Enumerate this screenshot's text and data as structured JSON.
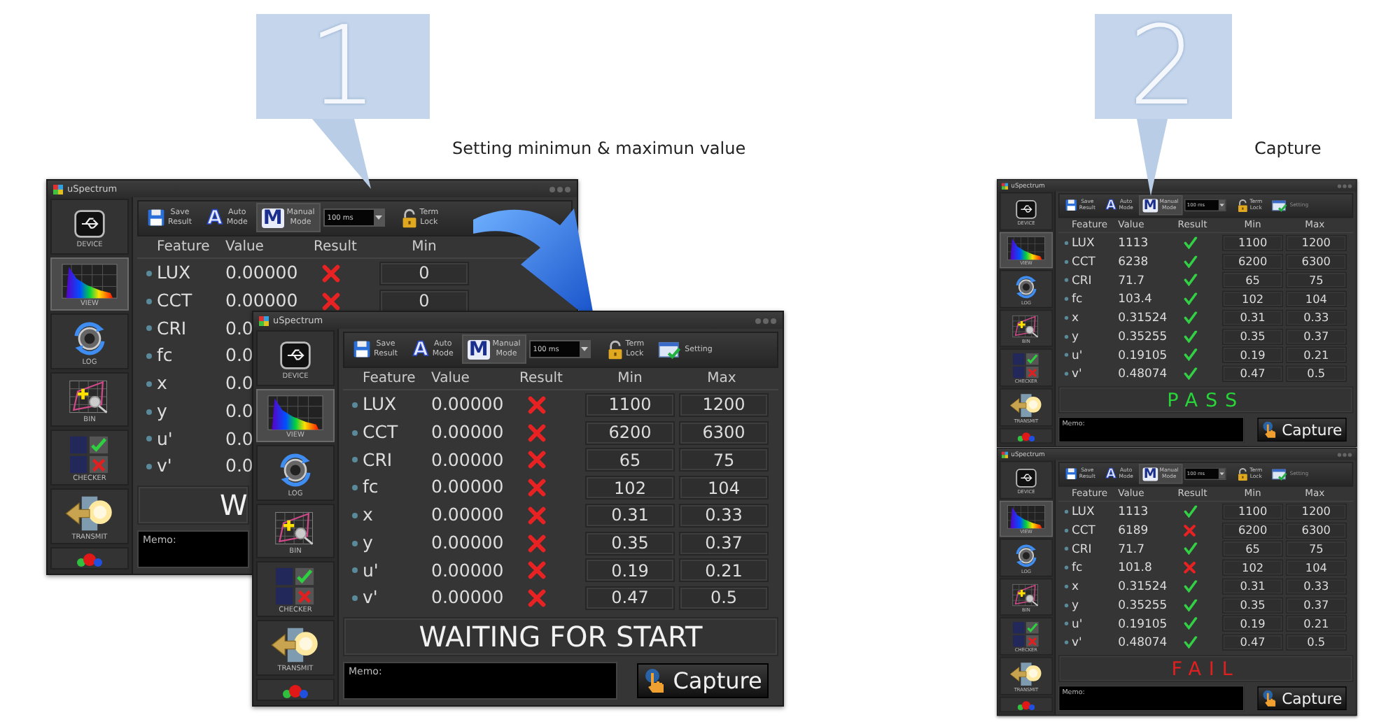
{
  "callouts": [
    {
      "number": "1",
      "caption": "Setting minimun & maximun value"
    },
    {
      "number": "2",
      "caption": "Capture"
    }
  ],
  "windows": [
    {
      "title": "uSpectrum",
      "sidebar": [
        {
          "kind": "device",
          "label": "DEVICE",
          "selected": false
        },
        {
          "kind": "view",
          "label": "VIEW",
          "selected": true
        },
        {
          "kind": "log",
          "label": "LOG",
          "selected": false
        },
        {
          "kind": "bin",
          "label": "BIN",
          "selected": false
        },
        {
          "kind": "checker",
          "label": "CHECKER",
          "selected": false
        },
        {
          "kind": "transmit",
          "label": "TRANSMIT",
          "selected": false
        },
        {
          "kind": "indicator",
          "selected": false
        }
      ],
      "toolbar": [
        {
          "kind": "save",
          "label": "Save\nResult"
        },
        {
          "kind": "mode",
          "glyph": "A",
          "label": "Auto\nMode",
          "selected": false
        },
        {
          "kind": "mode",
          "glyph": "M",
          "label": "Manual\nMode",
          "selected": true
        },
        {
          "kind": "dropdown",
          "value": "100 ms"
        },
        {
          "kind": "lock",
          "label": "Term\nLock"
        }
      ],
      "columns": [
        "Feature",
        "Value",
        "Result",
        "Min"
      ],
      "rows": [
        {
          "feature": "LUX",
          "value": "0.00000",
          "pass": false,
          "min": "0"
        },
        {
          "feature": "CCT",
          "value": "0.00000",
          "pass": false,
          "min": "0"
        },
        {
          "feature": "CRI",
          "value": "0.0"
        },
        {
          "feature": "fc",
          "value": "0.0"
        },
        {
          "feature": "x",
          "value": "0.0"
        },
        {
          "feature": "y",
          "value": "0.0"
        },
        {
          "feature": "u'",
          "value": "0.0"
        },
        {
          "feature": "v'",
          "value": "0.0"
        }
      ],
      "status": {
        "kind": "waiting",
        "text": "W"
      },
      "memo": "Memo:"
    },
    {
      "title": "uSpectrum",
      "sidebar": [
        {
          "kind": "device",
          "label": "DEVICE",
          "selected": false
        },
        {
          "kind": "view",
          "label": "VIEW",
          "selected": true
        },
        {
          "kind": "log",
          "label": "LOG",
          "selected": false
        },
        {
          "kind": "bin",
          "label": "BIN",
          "selected": false
        },
        {
          "kind": "checker",
          "label": "CHECKER",
          "selected": false
        },
        {
          "kind": "transmit",
          "label": "TRANSMIT",
          "selected": false
        },
        {
          "kind": "indicator",
          "selected": false
        }
      ],
      "toolbar": [
        {
          "kind": "save",
          "label": "Save\nResult"
        },
        {
          "kind": "mode",
          "glyph": "A",
          "label": "Auto\nMode",
          "selected": false
        },
        {
          "kind": "mode",
          "glyph": "M",
          "label": "Manual\nMode",
          "selected": true
        },
        {
          "kind": "dropdown",
          "value": "100 ms"
        },
        {
          "kind": "lock",
          "label": "Term\nLock"
        },
        {
          "kind": "setting",
          "label": "Setting",
          "disabled": false
        }
      ],
      "columns": [
        "Feature",
        "Value",
        "Result",
        "Min",
        "Max"
      ],
      "rows": [
        {
          "feature": "LUX",
          "value": "0.00000",
          "pass": false,
          "min": "1100",
          "max": "1200"
        },
        {
          "feature": "CCT",
          "value": "0.00000",
          "pass": false,
          "min": "6200",
          "max": "6300"
        },
        {
          "feature": "CRI",
          "value": "0.00000",
          "pass": false,
          "min": "65",
          "max": "75"
        },
        {
          "feature": "fc",
          "value": "0.00000",
          "pass": false,
          "min": "102",
          "max": "104"
        },
        {
          "feature": "x",
          "value": "0.00000",
          "pass": false,
          "min": "0.31",
          "max": "0.33"
        },
        {
          "feature": "y",
          "value": "0.00000",
          "pass": false,
          "min": "0.35",
          "max": "0.37"
        },
        {
          "feature": "u'",
          "value": "0.00000",
          "pass": false,
          "min": "0.19",
          "max": "0.21"
        },
        {
          "feature": "v'",
          "value": "0.00000",
          "pass": false,
          "min": "0.47",
          "max": "0.5"
        }
      ],
      "status": {
        "kind": "waiting",
        "text": "WAITING FOR START"
      },
      "memo": "Memo:",
      "capture": "Capture"
    },
    {
      "title": "uSpectrum",
      "sidebar": [
        {
          "kind": "device",
          "label": "DEVICE",
          "selected": false
        },
        {
          "kind": "view",
          "label": "VIEW",
          "selected": true
        },
        {
          "kind": "log",
          "label": "LOG",
          "selected": false
        },
        {
          "kind": "bin",
          "label": "BIN",
          "selected": false
        },
        {
          "kind": "checker",
          "label": "CHECKER",
          "selected": false
        },
        {
          "kind": "transmit",
          "label": "TRANSMIT",
          "selected": false
        },
        {
          "kind": "indicator",
          "selected": false
        }
      ],
      "toolbar": [
        {
          "kind": "save",
          "label": "Save\nResult"
        },
        {
          "kind": "mode",
          "glyph": "A",
          "label": "Auto\nMode",
          "selected": false
        },
        {
          "kind": "mode",
          "glyph": "M",
          "label": "Manual\nMode",
          "selected": true
        },
        {
          "kind": "dropdown",
          "value": "100 ms"
        },
        {
          "kind": "lock",
          "label": "Term\nLock"
        },
        {
          "kind": "setting",
          "label": "Setting",
          "disabled": true
        }
      ],
      "columns": [
        "Feature",
        "Value",
        "Result",
        "Min",
        "Max"
      ],
      "rows": [
        {
          "feature": "LUX",
          "value": "1113",
          "pass": true,
          "min": "1100",
          "max": "1200"
        },
        {
          "feature": "CCT",
          "value": "6238",
          "pass": true,
          "min": "6200",
          "max": "6300"
        },
        {
          "feature": "CRI",
          "value": "71.7",
          "pass": true,
          "min": "65",
          "max": "75"
        },
        {
          "feature": "fc",
          "value": "103.4",
          "pass": true,
          "min": "102",
          "max": "104"
        },
        {
          "feature": "x",
          "value": "0.31524",
          "pass": true,
          "min": "0.31",
          "max": "0.33"
        },
        {
          "feature": "y",
          "value": "0.35255",
          "pass": true,
          "min": "0.35",
          "max": "0.37"
        },
        {
          "feature": "u'",
          "value": "0.19105",
          "pass": true,
          "min": "0.19",
          "max": "0.21"
        },
        {
          "feature": "v'",
          "value": "0.48074",
          "pass": true,
          "min": "0.47",
          "max": "0.5"
        }
      ],
      "status": {
        "kind": "pass",
        "text": "PASS"
      },
      "memo": "Memo:",
      "capture": "Capture"
    },
    {
      "title": "uSpectrum",
      "sidebar": [
        {
          "kind": "device",
          "label": "DEVICE",
          "selected": false
        },
        {
          "kind": "view",
          "label": "VIEW",
          "selected": true
        },
        {
          "kind": "log",
          "label": "LOG",
          "selected": false
        },
        {
          "kind": "bin",
          "label": "BIN",
          "selected": false
        },
        {
          "kind": "checker",
          "label": "CHECKER",
          "selected": false
        },
        {
          "kind": "transmit",
          "label": "TRANSMIT",
          "selected": false
        },
        {
          "kind": "indicator",
          "selected": false
        }
      ],
      "toolbar": [
        {
          "kind": "save",
          "label": "Save\nResult"
        },
        {
          "kind": "mode",
          "glyph": "A",
          "label": "Auto\nMode",
          "selected": false
        },
        {
          "kind": "mode",
          "glyph": "M",
          "label": "Manual\nMode",
          "selected": true
        },
        {
          "kind": "dropdown",
          "value": "100 ms"
        },
        {
          "kind": "lock",
          "label": "Term\nLock"
        },
        {
          "kind": "setting",
          "label": "Setting",
          "disabled": true
        }
      ],
      "columns": [
        "Feature",
        "Value",
        "Result",
        "Min",
        "Max"
      ],
      "rows": [
        {
          "feature": "LUX",
          "value": "1113",
          "pass": true,
          "min": "1100",
          "max": "1200"
        },
        {
          "feature": "CCT",
          "value": "6189",
          "pass": false,
          "min": "6200",
          "max": "6300"
        },
        {
          "feature": "CRI",
          "value": "71.7",
          "pass": true,
          "min": "65",
          "max": "75"
        },
        {
          "feature": "fc",
          "value": "101.8",
          "pass": false,
          "min": "102",
          "max": "104"
        },
        {
          "feature": "x",
          "value": "0.31524",
          "pass": true,
          "min": "0.31",
          "max": "0.33"
        },
        {
          "feature": "y",
          "value": "0.35255",
          "pass": true,
          "min": "0.35",
          "max": "0.37"
        },
        {
          "feature": "u'",
          "value": "0.19105",
          "pass": true,
          "min": "0.19",
          "max": "0.21"
        },
        {
          "feature": "v'",
          "value": "0.48074",
          "pass": true,
          "min": "0.47",
          "max": "0.5"
        }
      ],
      "status": {
        "kind": "fail",
        "text": "FAIL"
      },
      "memo": "Memo:",
      "capture": "Capture"
    }
  ]
}
